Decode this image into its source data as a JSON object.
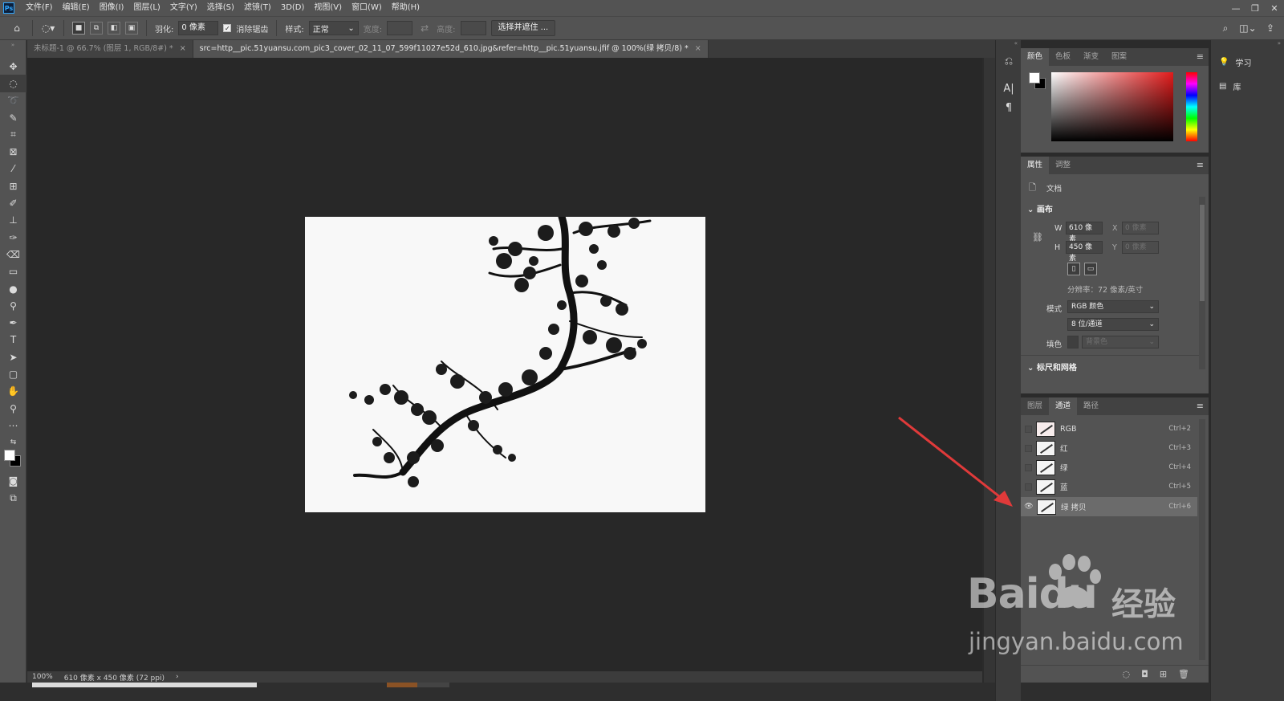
{
  "menubar": {
    "logo": "Ps",
    "items": [
      "文件(F)",
      "编辑(E)",
      "图像(I)",
      "图层(L)",
      "文字(Y)",
      "选择(S)",
      "滤镜(T)",
      "3D(D)",
      "视图(V)",
      "窗口(W)",
      "帮助(H)"
    ],
    "window_controls": [
      "—",
      "❐",
      "✕"
    ]
  },
  "options_bar": {
    "feather_label": "羽化:",
    "feather_value": "0 像素",
    "antialias_label": "消除锯齿",
    "antialias_checked": true,
    "style_label": "样式:",
    "style_value": "正常",
    "width_label": "宽度:",
    "height_label": "高度:",
    "select_mask_button": "选择并遮住 ..."
  },
  "document_tabs": [
    {
      "label": "未标题-1 @ 66.7% (图层 1, RGB/8#) *",
      "active": false
    },
    {
      "label": "src=http__pic.51yuansu.com_pic3_cover_02_11_07_599f11027e52d_610.jpg&refer=http__pic.51yuansu.jfif @ 100%(绿 拷贝/8) *",
      "active": true
    }
  ],
  "statusbar": {
    "zoom": "100%",
    "doc_info": "610 像素 x 450 像素 (72 ppi)",
    "arrow": "›"
  },
  "color_panel": {
    "tabs": [
      "颜色",
      "色板",
      "渐变",
      "图案"
    ],
    "active_tab": "颜色",
    "foreground": "#ffffff",
    "background": "#000000",
    "hue_color": "#e21b1b"
  },
  "properties_panel": {
    "tabs": [
      "属性",
      "调整"
    ],
    "active_tab": "属性",
    "doc_label": "文档",
    "canvas_heading": "画布",
    "w_label": "W",
    "w_value": "610 像素",
    "h_label": "H",
    "h_value": "450 像素",
    "x_label": "X",
    "x_value": "0 像素",
    "y_label": "Y",
    "y_value": "0 像素",
    "resolution": "分辨率：72 像素/英寸",
    "mode_label": "模式",
    "mode_value": "RGB 颜色",
    "depth_value": "8 位/通道",
    "fill_label": "填色",
    "fill_value": "背景色",
    "rulers_heading": "标尺和网格"
  },
  "channels_panel": {
    "tabs": [
      "图层",
      "通道",
      "路径"
    ],
    "active_tab": "通道",
    "channels": [
      {
        "name": "RGB",
        "shortcut": "Ctrl+2",
        "visible": false,
        "selected": false
      },
      {
        "name": "红",
        "shortcut": "Ctrl+3",
        "visible": false,
        "selected": false
      },
      {
        "name": "绿",
        "shortcut": "Ctrl+4",
        "visible": false,
        "selected": false
      },
      {
        "name": "蓝",
        "shortcut": "Ctrl+5",
        "visible": false,
        "selected": false
      },
      {
        "name": "绿 拷贝",
        "shortcut": "Ctrl+6",
        "visible": true,
        "selected": true
      }
    ]
  },
  "right_dock": {
    "items": [
      {
        "label": "学习",
        "icon": "lightbulb-icon"
      },
      {
        "label": "库",
        "icon": "library-icon"
      }
    ]
  },
  "watermark": {
    "logo": "Bai",
    "logo_suffix": "du",
    "cn": "经验",
    "url": "jingyan.baidu.com"
  },
  "annotation": {
    "arrow_color": "#e03a3a"
  }
}
